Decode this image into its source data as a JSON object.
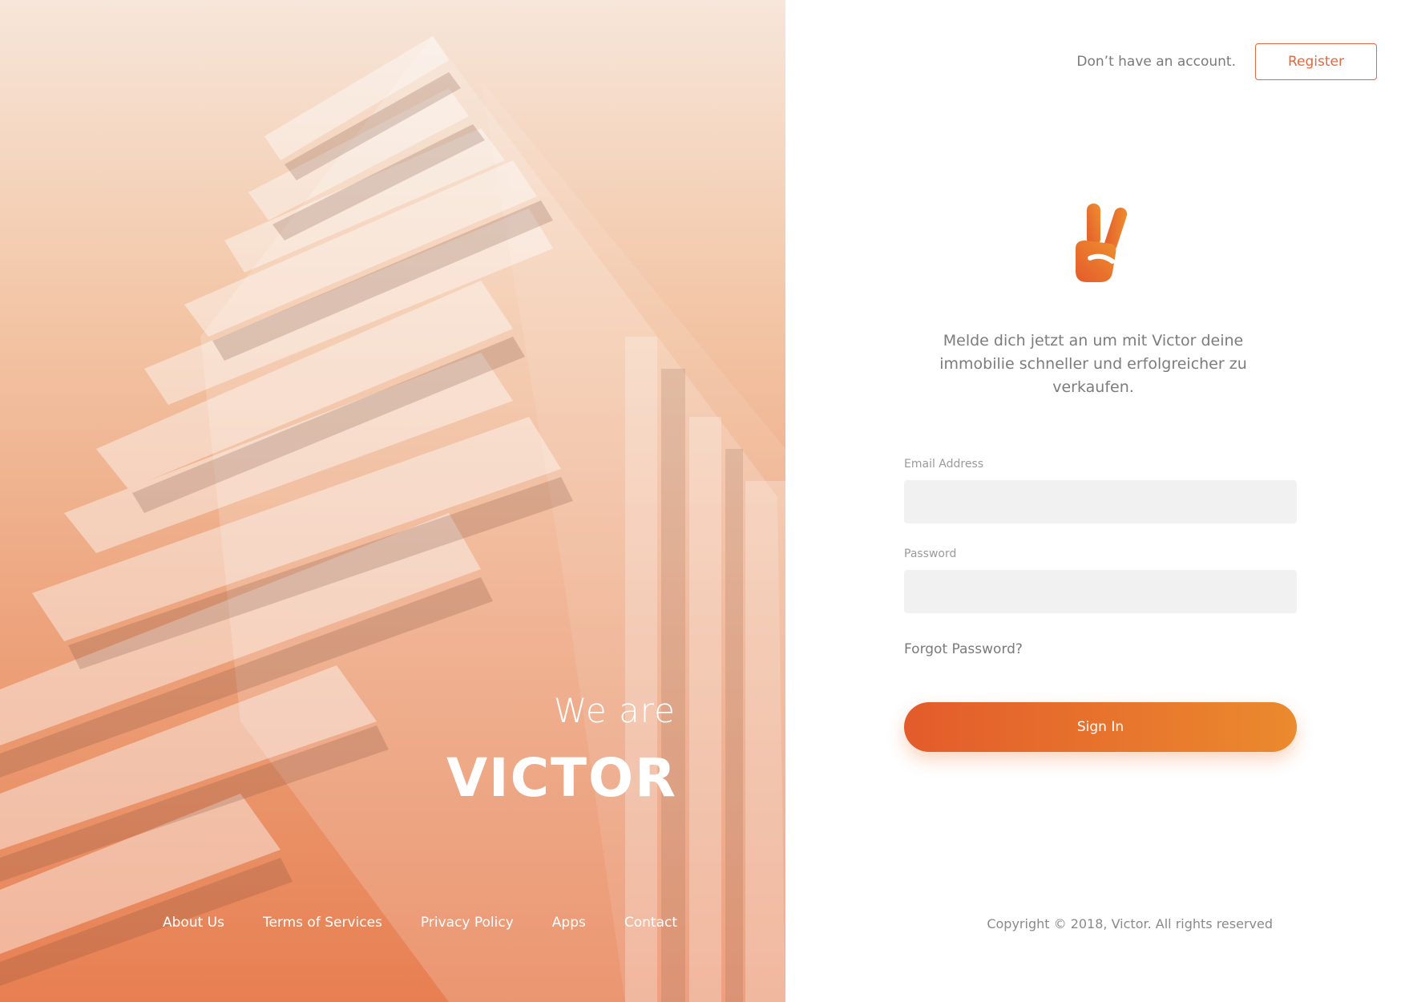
{
  "hero": {
    "title_small": "We are",
    "title_big": "VICTOR",
    "footer_links": [
      "About Us",
      "Terms of Services",
      "Privacy Policy",
      "Apps",
      "Contact"
    ]
  },
  "header": {
    "prompt": "Don’t have an account.",
    "register_label": "Register"
  },
  "logo": {
    "icon": "victory-hand-icon",
    "color": "#e8692d"
  },
  "tagline": "Melde dich jetzt an um mit Victor deine immobilie schneller und erfolgreicher zu verkaufen.",
  "form": {
    "email_label": "Email Address",
    "email_value": "",
    "password_label": "Password",
    "password_value": "",
    "forgot_label": "Forgot Password?",
    "signin_label": "Sign In"
  },
  "footer": {
    "copyright": "Copyright © 2018, Victor. All rights reserved"
  },
  "colors": {
    "accent": "#e4683a",
    "gradient_start": "#e35b2b",
    "gradient_end": "#eb8a2e",
    "field_bg": "#f1f1f1"
  }
}
